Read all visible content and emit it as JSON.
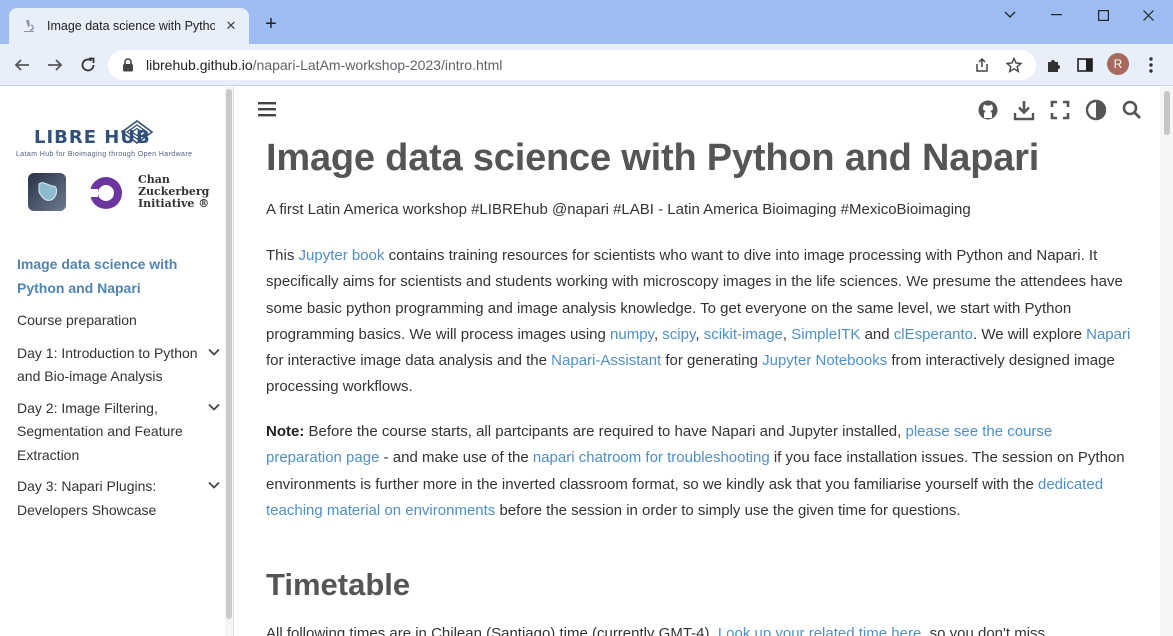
{
  "browser": {
    "tab_title": "Image data science with Python",
    "url_host": "librehub.github.io",
    "url_path": "/napari-LatAm-workshop-2023/intro.html",
    "avatar_letter": "R"
  },
  "sidebar": {
    "logo_title": "LIBRE HUB",
    "logo_subtitle": "Latam Hub for Bioimaging through Open Hardware",
    "czi_line1": "Chan",
    "czi_line2": "Zuckerberg",
    "czi_line3": "Initiative ®",
    "items": [
      {
        "label": "Image data science with Python and Napari",
        "active": true
      },
      {
        "label": "Course preparation"
      },
      {
        "label": "Day 1: Introduction to Python and Bio-image Analysis"
      },
      {
        "label": "Day 2: Image Filtering, Segmentation and Feature Extraction"
      },
      {
        "label": "Day 3: Napari Plugins: Developers Showcase"
      }
    ]
  },
  "main": {
    "title": "Image data science with Python and Napari",
    "subtitle": "A first Latin America workshop #LIBREhub @napari #LABI - Latin America Bioimaging #MexicoBioimaging",
    "p1": {
      "t1": "This ",
      "l1": "Jupyter book",
      "t2": " contains training resources for scientists who want to dive into image processing with Python and Napari. It specifically aims for scientists and students working with microscopy images in the life sciences. We presume the attendees have some basic python programming and image analysis knowledge. To get everyone on the same level, we start with Python programming basics. We will process images using ",
      "l2": "numpy",
      "s1": ", ",
      "l3": "scipy",
      "s2": ", ",
      "l4": "scikit-image",
      "s3": ", ",
      "l5": "SimpleITK",
      "t3": " and ",
      "l6": "clEsperanto",
      "t4": ". We will explore ",
      "l7": "Napari",
      "t5": " for interactive image data analysis and the ",
      "l8": "Napari-Assistant",
      "t6": " for generating ",
      "l9": "Jupyter Notebooks",
      "t7": " from interactively designed image processing workflows."
    },
    "p2": {
      "bold": "Note:",
      "t1": " Before the course starts, all partcipants are required to have Napari and Jupyter installed, ",
      "l1": "please see the course preparation page",
      "t2": " - and make use of the ",
      "l2": "napari chatroom for troubleshooting",
      "t3": " if you face installation issues. The session on Python environments is further more in the inverted classroom format, so we kindly ask that you familiarise yourself with the ",
      "l3": "dedicated teaching material on environments",
      "t4": " before the session in order to simply use the given time for questions."
    },
    "h2": "Timetable",
    "cut_t1": "All following times are in Chilean (Santiago) time (currently GMT-4). ",
    "cut_l1": "Look up your related time here",
    "cut_t2": ", so you don't miss"
  }
}
